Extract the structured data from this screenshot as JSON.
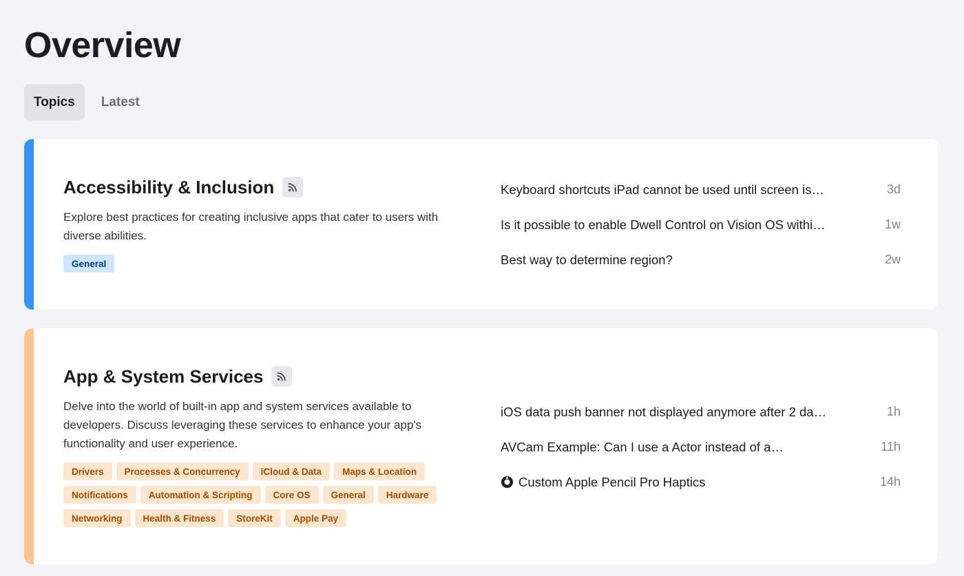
{
  "page": {
    "title": "Overview"
  },
  "tabs": [
    {
      "label": "Topics",
      "active": true
    },
    {
      "label": "Latest",
      "active": false
    }
  ],
  "colors": {
    "accent_blue": "#3393f0",
    "accent_orange": "#fac590",
    "tag_blue_bg": "#cfe5fb",
    "tag_orange_bg": "#fde6cd"
  },
  "topics": [
    {
      "title": "Accessibility & Inclusion",
      "rss_icon": "rss-icon",
      "description": "Explore best practices for creating inclusive apps that cater to users with diverse abilities.",
      "tags": [
        "General"
      ],
      "threads": [
        {
          "title": "Keyboard shortcuts iPad cannot be used until screen is…",
          "time": "3d"
        },
        {
          "title": "Is it possible to enable Dwell Control on Vision OS withi…",
          "time": "1w"
        },
        {
          "title": "Best way to determine region?",
          "time": "2w"
        }
      ]
    },
    {
      "title": "App & System Services",
      "rss_icon": "rss-icon",
      "description": "Delve into the world of built-in app and system services available to developers. Discuss leveraging these services to enhance your app's functionality and user experience.",
      "tags": [
        "Drivers",
        "Processes & Concurrency",
        "iCloud & Data",
        "Maps & Location",
        "Notifications",
        "Automation & Scripting",
        "Core OS",
        "General",
        "Hardware",
        "Networking",
        "Health & Fitness",
        "StoreKit",
        "Apple Pay"
      ],
      "threads": [
        {
          "title": "iOS data push banner not displayed anymore after 2 da…",
          "time": "1h"
        },
        {
          "title": "AVCam Example: Can I use a Actor instead of a…",
          "time": "11h"
        },
        {
          "title": "Custom Apple Pencil Pro Haptics",
          "time": "14h",
          "icon": "solved-check-icon"
        }
      ]
    }
  ]
}
